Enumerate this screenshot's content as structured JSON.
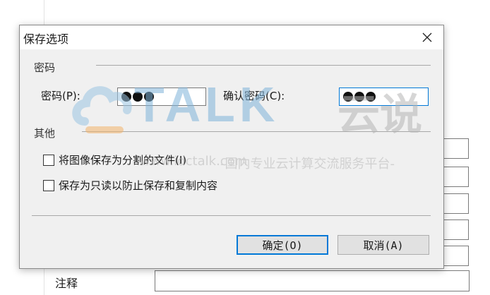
{
  "dialog": {
    "title": "保存选项",
    "password_group": {
      "title": "密码",
      "password_label": "密码(P):",
      "confirm_label": "确认密码(C):",
      "password_masked_count": 3,
      "confirm_masked_count": 3
    },
    "other_group": {
      "title": "其他",
      "options": [
        {
          "label": "将图像保存为分割的文件(I)",
          "checked": false
        },
        {
          "label": "保存为只读以防止保存和复制内容",
          "checked": false
        }
      ]
    },
    "buttons": {
      "ok": "确定(O)",
      "cancel": "取消(A)"
    }
  },
  "background": {
    "note_label": "注释"
  },
  "watermark": {
    "brand": "TALK",
    "brand_cn": "云说",
    "url": "www.idctalk.com",
    "slogan": "-国内专业云计算交流服务平台-"
  },
  "colors": {
    "accent": "#0078d7",
    "dialog_bg": "#f0f0f0"
  },
  "icons": {
    "close": "close-icon",
    "watermark_logo": "cloud-logo-icon"
  }
}
